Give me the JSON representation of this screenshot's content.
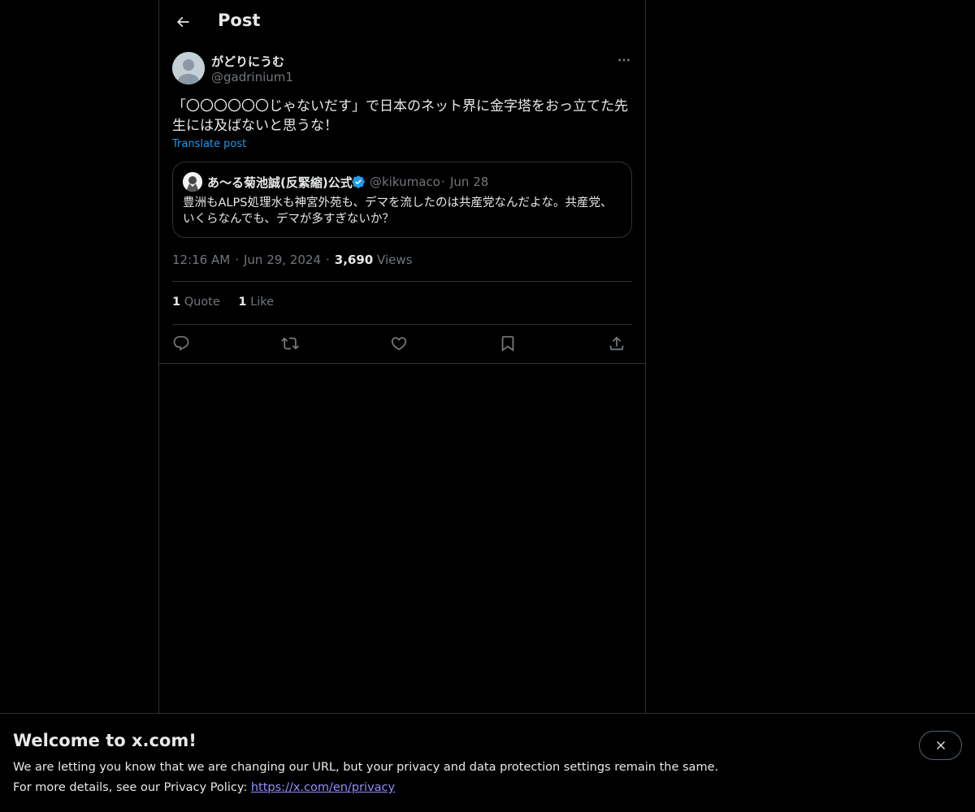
{
  "header": {
    "title": "Post",
    "back_icon": "arrow-left-icon"
  },
  "post": {
    "author_name": "がどりにうむ",
    "author_handle": "@gadrinium1",
    "text": "「〇〇〇〇〇〇じゃないだす」で日本のネット界に金字塔をおっ立てた先生には及ばないと思うな！",
    "translate_label": "Translate post",
    "time": "12:16 AM",
    "date": "Jun 29, 2024",
    "views_count": "3,690",
    "views_label": "Views",
    "separator": "·"
  },
  "quote": {
    "name": "あ〜る菊池誠(反緊縮)公式",
    "handle": "@kikumaco",
    "separator": "·",
    "date": "Jun 28",
    "text": "豊洲もALPS処理水も神宮外苑も、デマを流したのは共産党なんだよな。共産党、いくらなんでも、デマが多すぎないか？",
    "verified_color": "#1d9bf0"
  },
  "stats": {
    "quotes_count": "1",
    "quotes_label": "Quote",
    "likes_count": "1",
    "likes_label": "Like"
  },
  "actions": [
    "reply-icon",
    "repost-icon",
    "like-icon",
    "bookmark-icon",
    "share-icon"
  ],
  "banner": {
    "title": "Welcome to x.com!",
    "line1": "We are letting you know that we are changing our URL, but your privacy and data protection settings remain the same.",
    "line2_prefix": "For more details, see our Privacy Policy: ",
    "link": "https://x.com/en/privacy"
  },
  "colors": {
    "background": "#000000",
    "text": "#e7e9ea",
    "muted": "#71767b",
    "accent": "#1d9bf0",
    "border": "#2f3336"
  }
}
